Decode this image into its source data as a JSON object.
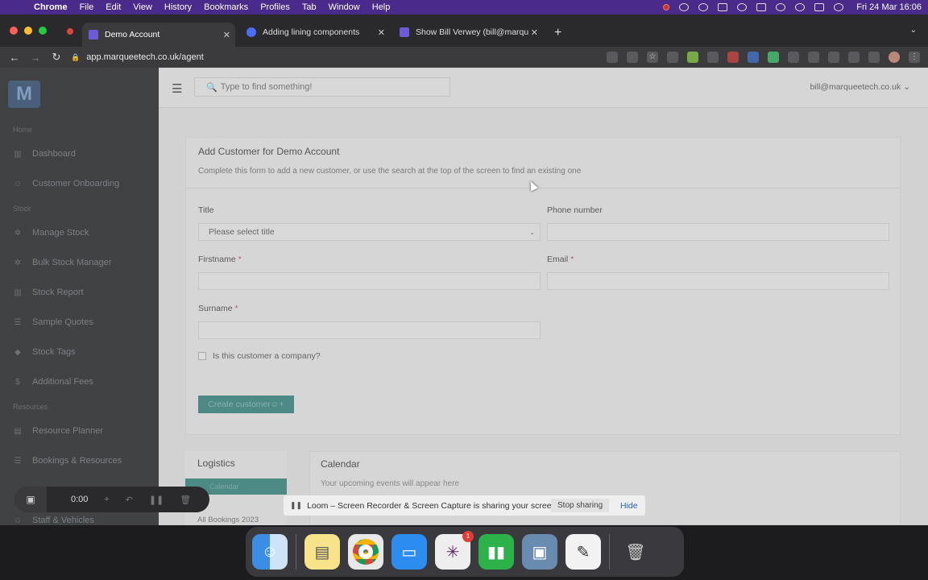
{
  "menubar": {
    "app": "Chrome",
    "items": [
      "File",
      "Edit",
      "View",
      "History",
      "Bookmarks",
      "Profiles",
      "Tab",
      "Window",
      "Help"
    ],
    "clock": "Fri 24 Mar  16:06"
  },
  "browser": {
    "tabs": [
      {
        "title": "Demo Account",
        "color": "#6b5bd6"
      },
      {
        "title": "Adding lining components",
        "color": "#4a6cf7"
      },
      {
        "title": "Show Bill Verwey (bill@marque",
        "color": "#6b5bd6"
      }
    ],
    "url": "app.marqueetech.co.uk/agent"
  },
  "sidebar": {
    "sections": [
      "Home",
      "Stock",
      "Resources"
    ],
    "items": [
      {
        "label": "Dashboard",
        "icon": "chart-icon"
      },
      {
        "label": "Customer Onboarding",
        "icon": "users-icon"
      },
      {
        "label": "Manage Stock",
        "icon": "gear-icon"
      },
      {
        "label": "Bulk Stock Manager",
        "icon": "gear-icon"
      },
      {
        "label": "Stock Report",
        "icon": "chart-icon"
      },
      {
        "label": "Sample Quotes",
        "icon": "list-icon"
      },
      {
        "label": "Stock Tags",
        "icon": "tag-icon"
      },
      {
        "label": "Additional Fees",
        "icon": "dollar-icon"
      },
      {
        "label": "Resource Planner",
        "icon": "doc-icon"
      },
      {
        "label": "Bookings & Resources",
        "icon": "list-icon"
      },
      {
        "label": "Staff & Vehicles",
        "icon": "users-icon"
      }
    ]
  },
  "topbar": {
    "search_placeholder": "Type to find something!",
    "user": "bill@marqueetech.co.uk"
  },
  "form": {
    "title": "Add Customer for Demo Account",
    "subtitle": "Complete this form to add a new customer, or use the search at the top of the screen to find an existing one",
    "title_label": "Title",
    "title_select": "Please select title",
    "phone_label": "Phone number",
    "firstname_label": "Firstname",
    "email_label": "Email",
    "surname_label": "Surname",
    "required_mark": "*",
    "company_label": "Is this customer a company?",
    "create_button": "Create customer"
  },
  "logistics": {
    "title": "Logistics",
    "tab": "Calendar",
    "all_bookings": "All Bookings 2023"
  },
  "calendar": {
    "title": "Calendar",
    "empty": "Your upcoming events will appear here"
  },
  "loom": {
    "time": "0:00",
    "message": "Loom – Screen Recorder & Screen Capture is sharing your screen.",
    "stop": "Stop sharing",
    "hide": "Hide"
  },
  "dock": {
    "slack_badge": "1"
  }
}
